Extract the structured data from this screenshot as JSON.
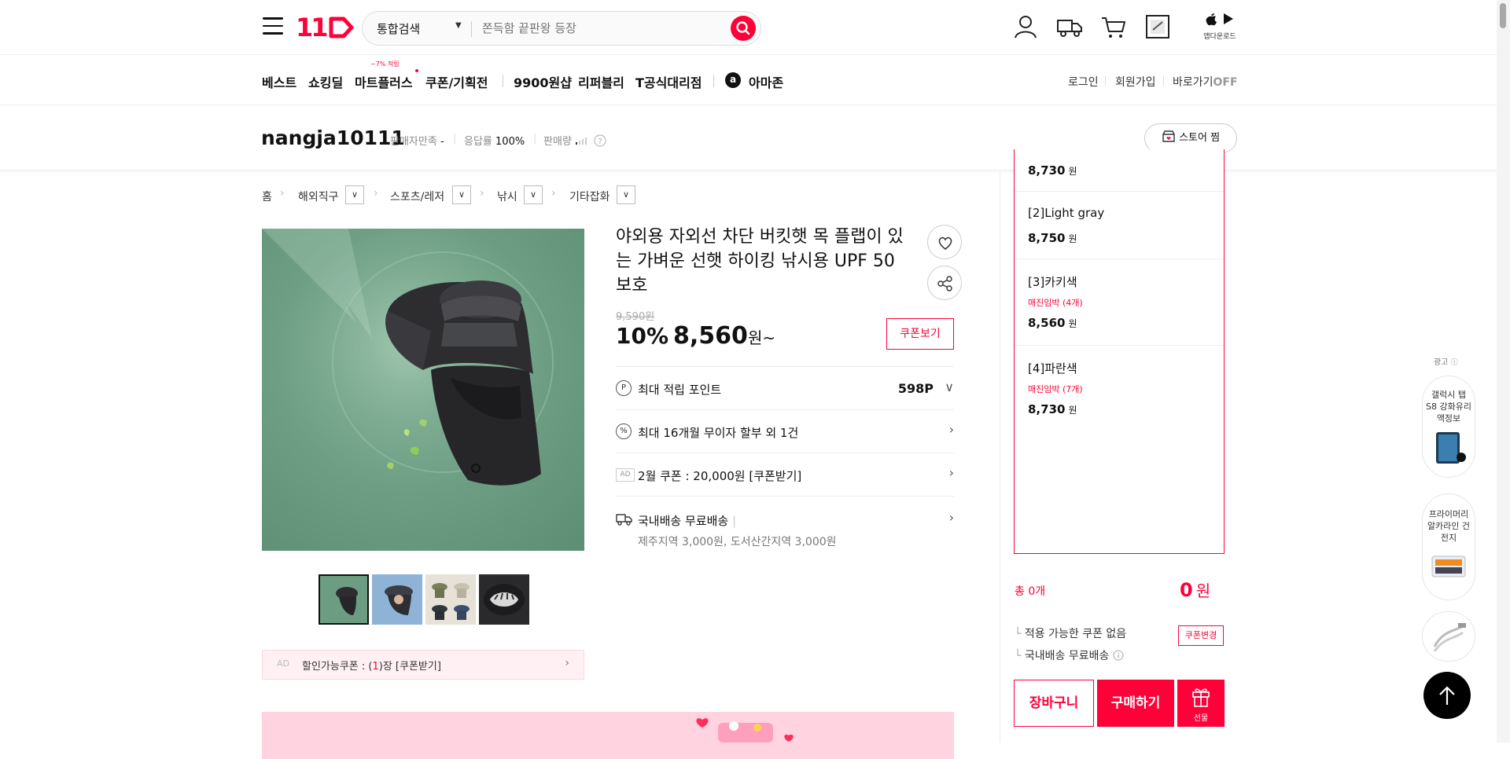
{
  "header": {
    "logo": "11",
    "search": {
      "category": "통합검색",
      "placeholder": "쫀득함 끝판왕 등장"
    },
    "app_download_label": "앱다운로드"
  },
  "nav": {
    "items": [
      "베스트",
      "쇼킹딜",
      "마트플러스",
      "쿠폰/기획전",
      "9900원샵",
      "리퍼블리",
      "T공식대리점",
      "아마존"
    ],
    "mart_badge": "~7% 적립",
    "right": [
      "로그인",
      "회원가입",
      "바로가기"
    ],
    "shortcut_state": "OFF"
  },
  "seller": {
    "name": "nangja10111",
    "satisfaction_label": "판매자만족",
    "satisfaction_value": "-",
    "response_label": "응답률",
    "response_value": "100%",
    "sales_label": "판매량",
    "store_button": "스토어 찜"
  },
  "breadcrumb": [
    "홈",
    "해외직구",
    "스포츠/레저",
    "낚시",
    "기타잡화"
  ],
  "product": {
    "title": "야외용 자외선 차단 버킷햇 목 플랩이 있는 가벼운 선햇 하이킹 낚시용 UPF 50 보호",
    "original_price": "9,590원",
    "discount": "10%",
    "price": "8,560",
    "price_unit": "원~",
    "coupon_button": "쿠폰보기",
    "points_label": "최대 적립 포인트",
    "points_value": "598P",
    "installment_label": "최대 16개월 무이자 할부 외 1건",
    "ad_tag": "AD",
    "coupon_ad_label": "2월 쿠폰 : 20,000원 [쿠폰받기]",
    "shipping_label": "국내배송 무료배송",
    "shipping_extra": "제주지역 3,000원, 도서산간지역 3,000원",
    "discount_coupon_bar": {
      "ad_tag": "AD",
      "prefix": "할인가능쿠폰 : (",
      "count": "1",
      "suffix": ")장 [쿠폰받기]"
    }
  },
  "options": [
    {
      "name": "",
      "stock": "",
      "price": "8,730",
      "unit": "원"
    },
    {
      "name": "[2]Light gray",
      "stock": "",
      "price": "8,750",
      "unit": "원"
    },
    {
      "name": "[3]카키색",
      "stock": "매진임박 (4개)",
      "price": "8,560",
      "unit": "원"
    },
    {
      "name": "[4]파란색",
      "stock": "매진임박 (7개)",
      "price": "8,730",
      "unit": "원"
    }
  ],
  "order": {
    "total_label": "총 0개",
    "total_value": "0",
    "total_unit": "원",
    "coupon_note": "적용 가능한 쿠폰 없음",
    "coupon_change": "쿠폰변경",
    "shipping_note": "국내배송 무료배송",
    "cart_button": "장바구니",
    "buy_button": "구매하기",
    "gift_button": "선물"
  },
  "side_ads": {
    "label": "광고",
    "cards": [
      "갤럭시 탭 S8 강화유리 액정보",
      "프라이머리 알카라인 건전지",
      ""
    ]
  },
  "colors": {
    "brand": "#ff0038",
    "image_bg": "#6c9d82"
  }
}
